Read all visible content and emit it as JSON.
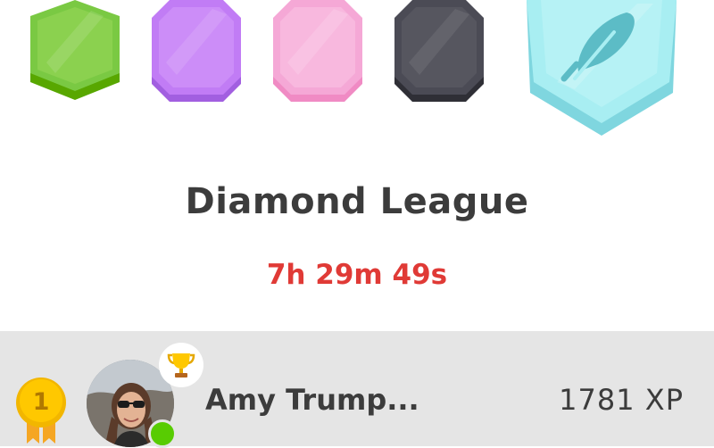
{
  "header": {
    "league_title": "Diamond League",
    "countdown": "7h 29m 49s"
  },
  "badges": [
    {
      "name": "green-league-badge",
      "color": "#7ac943"
    },
    {
      "name": "purple-league-badge",
      "color": "#c17cf5"
    },
    {
      "name": "pink-league-badge",
      "color": "#f5a8d6"
    },
    {
      "name": "dark-league-badge",
      "color": "#4b4b55"
    },
    {
      "name": "diamond-league-badge",
      "color": "#a8eef2",
      "icon": "feather-icon"
    }
  ],
  "leaderboard": {
    "rows": [
      {
        "rank": "1",
        "name": "Amy Trump...",
        "xp": "1781 XP",
        "icon": "trophy-icon",
        "status": "online"
      }
    ]
  },
  "colors": {
    "countdown": "#e03a36",
    "row_background": "#e5e5e5",
    "online": "#58cc02",
    "medal": "#ffc800"
  }
}
